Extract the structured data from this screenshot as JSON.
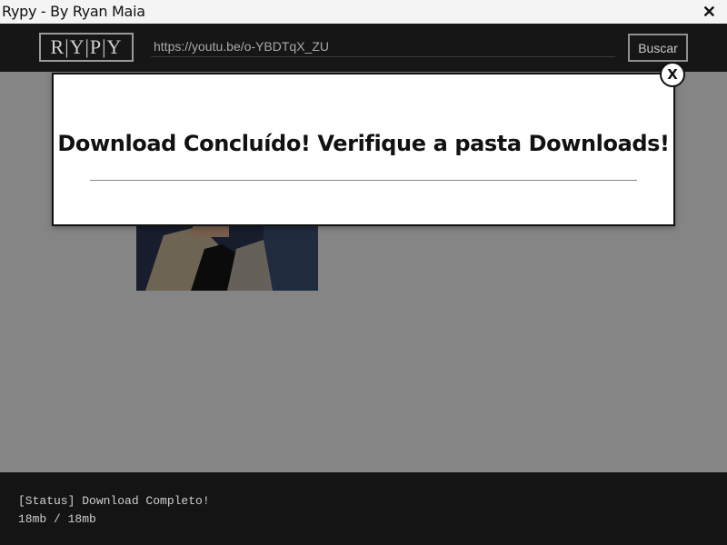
{
  "window": {
    "title": "Rypy - By Ryan Maia",
    "close_label": "✕"
  },
  "header": {
    "logo": "R|Y|P|Y",
    "url_value": "https://youtu.be/o-YBDTqX_ZU",
    "search_label": "Buscar"
  },
  "modal": {
    "message": "Download Concluído! Verifique a pasta Downloads!",
    "close_label": "X"
  },
  "status": {
    "line": "[Status] Download Completo!",
    "progress": "18mb / 18mb"
  },
  "colors": {
    "header_bg": "#161616",
    "footer_bg": "#141414",
    "modal_bg": "#ffffff"
  }
}
